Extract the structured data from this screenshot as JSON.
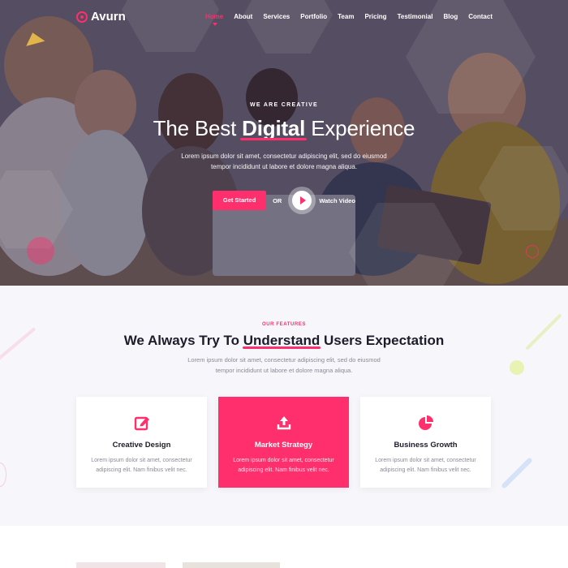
{
  "brand": {
    "name": "Avurn",
    "accent": "#ff2e6c"
  },
  "nav": {
    "items": [
      {
        "label": "Home",
        "active": true
      },
      {
        "label": "About",
        "active": false
      },
      {
        "label": "Services",
        "active": false
      },
      {
        "label": "Portfolio",
        "active": false
      },
      {
        "label": "Team",
        "active": false
      },
      {
        "label": "Pricing",
        "active": false
      },
      {
        "label": "Testimonial",
        "active": false
      },
      {
        "label": "Blog",
        "active": false
      },
      {
        "label": "Contact",
        "active": false
      }
    ]
  },
  "hero": {
    "eyebrow": "WE ARE CREATIVE",
    "title_before": "The Best ",
    "title_highlight": "Digital",
    "title_after": " Experience",
    "description": "Lorem ipsum dolor sit amet, consectetur adipiscing elit, sed do eiusmod tempor incididunt ut labore et dolore magna aliqua.",
    "cta_label": "Get Started",
    "or_label": "OR",
    "video_label": "Watch Video"
  },
  "features": {
    "eyebrow": "OUR FEATURES",
    "title_before": "We Always Try To ",
    "title_highlight": "Understand",
    "title_after": " Users Expectation",
    "description": "Lorem ipsum dolor sit amet, consectetur adipiscing elit, sed do eiusmod tempor incididunt ut labore et dolore magna aliqua.",
    "cards": [
      {
        "icon": "edit-icon",
        "title": "Creative Design",
        "text": "Lorem ipsum dolor sit amet, consectetur adipiscing elit. Nam finibus velit nec.",
        "active": false
      },
      {
        "icon": "upload-icon",
        "title": "Market Strategy",
        "text": "Lorem ipsum dolor sit amet, consectetur adipiscing elit. Nam finibus velit nec.",
        "active": true
      },
      {
        "icon": "pie-chart-icon",
        "title": "Business Growth",
        "text": "Lorem ipsum dolor sit amet, consectetur adipiscing elit. Nam finibus velit nec.",
        "active": false
      }
    ]
  }
}
